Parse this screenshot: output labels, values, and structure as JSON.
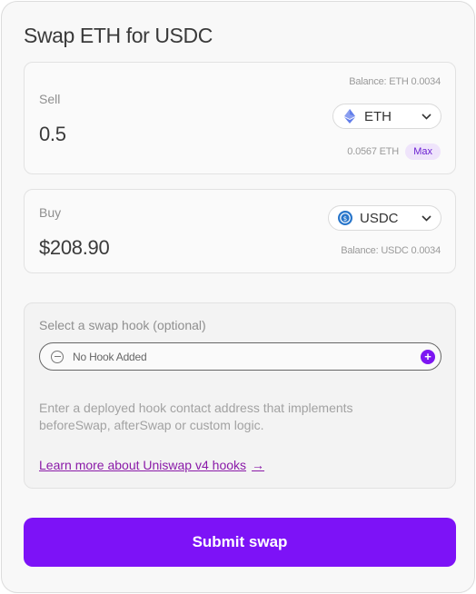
{
  "header": {
    "title": "Swap ETH for USDC"
  },
  "sell": {
    "label": "Sell",
    "amount": "0.5",
    "balance_label": "Balance:",
    "balance_token": "ETH",
    "balance_value": "0.0034",
    "token": {
      "symbol": "ETH",
      "icon": "ethereum-icon"
    },
    "sub_value": "0.0567 ETH",
    "max_label": "Max"
  },
  "buy": {
    "label": "Buy",
    "amount": "$208.90",
    "balance_label": "Balance:",
    "balance_token": "USDC",
    "balance_value": "0.0034",
    "token": {
      "symbol": "USDC",
      "icon": "usdc-icon"
    }
  },
  "hook": {
    "label": "Select a swap hook (optional)",
    "field_text": "No Hook Added",
    "description": "Enter a deployed hook contact address that implements beforeSwap, afterSwap or custom logic.",
    "link_text": "Learn more about Uniswap v4 hooks",
    "link_arrow": "→"
  },
  "submit": {
    "label": "Submit swap"
  },
  "colors": {
    "accent": "#7d12f7",
    "link": "#8a1aa8",
    "max_badge_bg": "#efe4fb",
    "usdc_blue": "#2775ca",
    "eth_purple": "#627eea"
  }
}
